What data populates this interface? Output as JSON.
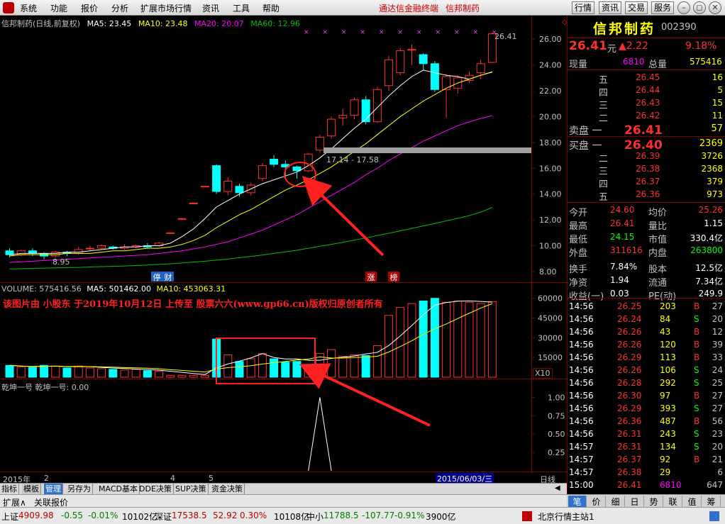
{
  "menu": {
    "logo_icon": "app-logo-icon",
    "items": [
      "系统",
      "功能",
      "报价",
      "分析",
      "扩展市场行情",
      "资讯",
      "工具",
      "帮助"
    ],
    "notice_app": "通达信金融终端",
    "notice_stock": "信邦制药",
    "right_buttons": [
      "行情",
      "资讯",
      "交易",
      "服务"
    ]
  },
  "chart": {
    "title": "信邦制药(日线,前复权)",
    "ma5": "MA5: 23.45",
    "ma10": "MA10: 23.48",
    "ma20": "MA20: 20.07",
    "ma60": "MA60: 12.96",
    "last_price_label": "26.41",
    "low_label": "8.95",
    "range_label": "17.14 - 17.58",
    "tag_ting": "停",
    "tag_cai": "财",
    "tag_zhang": "涨",
    "tag_bang": "榜",
    "volume_legend": {
      "vol": "VOLUME: 575416.56",
      "ma5": "MA5: 501462.00",
      "ma10": "MA10: 453063.31"
    },
    "watermark": "该图片由 小股东 于2019年10月12日 上传至 股票六六(www.gp66.cn)版权归原创者所有",
    "x10_label": "X10",
    "indicator_legend": "乾坤一号  乾坤一号: 0.00",
    "date_axis": [
      "2015年",
      "2",
      "4",
      "5"
    ],
    "cursor_date": "2015/06/03/三",
    "period_label": "日线",
    "colors": {
      "up": "#ff3030",
      "down": "#00ffff",
      "ma5": "#ffffff",
      "ma10": "#ffff00",
      "ma20": "#ff00ff",
      "ma60": "#00c000"
    }
  },
  "chart_data": [
    {
      "type": "candlestick",
      "title": "信邦制药(日线,前复权)",
      "ylim": [
        7.5,
        27
      ],
      "y_ticks": [
        "26.00",
        "24.00",
        "22.00",
        "20.00",
        "18.00",
        "16.00",
        "14.00",
        "12.00",
        "10.00",
        "8.00"
      ],
      "candles": [
        {
          "o": 9.6,
          "c": 9.3,
          "h": 9.8,
          "l": 9.1
        },
        {
          "o": 9.3,
          "c": 9.6,
          "h": 9.7,
          "l": 9.2
        },
        {
          "o": 9.6,
          "c": 9.4,
          "h": 9.8,
          "l": 9.2
        },
        {
          "o": 9.4,
          "c": 9.2,
          "h": 9.5,
          "l": 8.95
        },
        {
          "o": 9.2,
          "c": 9.5,
          "h": 9.6,
          "l": 9.1
        },
        {
          "o": 9.5,
          "c": 9.4,
          "h": 9.6,
          "l": 9.2
        },
        {
          "o": 9.4,
          "c": 9.7,
          "h": 9.9,
          "l": 9.3
        },
        {
          "o": 9.8,
          "c": 9.8,
          "h": 10.0,
          "l": 9.6
        },
        {
          "o": 9.8,
          "c": 10.0,
          "h": 10.1,
          "l": 9.7
        },
        {
          "o": 9.9,
          "c": 9.8,
          "h": 10.0,
          "l": 9.7
        },
        {
          "o": 9.8,
          "c": 9.9,
          "h": 10.1,
          "l": 9.7
        },
        {
          "o": 9.9,
          "c": 10.0,
          "h": 10.1,
          "l": 9.8
        },
        {
          "o": 10.0,
          "c": 9.9,
          "h": 10.2,
          "l": 9.8
        },
        {
          "o": 10.0,
          "c": 10.2,
          "h": 10.3,
          "l": 9.9
        },
        {
          "o": 11.0,
          "c": 11.0,
          "h": 11.0,
          "l": 11.0
        },
        {
          "o": 12.1,
          "c": 12.1,
          "h": 12.1,
          "l": 12.1
        },
        {
          "o": 13.3,
          "c": 13.3,
          "h": 13.3,
          "l": 13.3
        },
        {
          "o": 14.6,
          "c": 14.6,
          "h": 14.6,
          "l": 14.6
        },
        {
          "o": 16.2,
          "c": 14.2,
          "h": 16.3,
          "l": 14.0
        },
        {
          "o": 14.2,
          "c": 15.0,
          "h": 15.3,
          "l": 13.9
        },
        {
          "o": 14.6,
          "c": 14.1,
          "h": 14.8,
          "l": 13.8
        },
        {
          "o": 14.1,
          "c": 14.7,
          "h": 14.9,
          "l": 13.9
        },
        {
          "o": 15.2,
          "c": 16.2,
          "h": 16.4,
          "l": 15.0
        },
        {
          "o": 16.7,
          "c": 16.3,
          "h": 17.0,
          "l": 16.1
        },
        {
          "o": 16.3,
          "c": 16.1,
          "h": 16.6,
          "l": 15.3
        },
        {
          "o": 16.1,
          "c": 15.8,
          "h": 16.2,
          "l": 15.2
        },
        {
          "o": 15.8,
          "c": 17.1,
          "h": 17.2,
          "l": 15.7
        },
        {
          "o": 17.4,
          "c": 18.4,
          "h": 18.6,
          "l": 17.2
        },
        {
          "o": 18.5,
          "c": 19.8,
          "h": 20.0,
          "l": 18.3
        },
        {
          "o": 19.9,
          "c": 20.1,
          "h": 20.6,
          "l": 19.3
        },
        {
          "o": 20.1,
          "c": 21.3,
          "h": 21.5,
          "l": 19.8
        },
        {
          "o": 21.3,
          "c": 19.6,
          "h": 21.6,
          "l": 19.4
        },
        {
          "o": 19.6,
          "c": 22.1,
          "h": 22.3,
          "l": 19.5
        },
        {
          "o": 22.4,
          "c": 24.4,
          "h": 24.7,
          "l": 22.0
        },
        {
          "o": 23.4,
          "c": 25.1,
          "h": 25.3,
          "l": 23.2
        },
        {
          "o": 25.2,
          "c": 25.2,
          "h": 25.6,
          "l": 24.0
        },
        {
          "o": 24.8,
          "c": 24.1,
          "h": 24.9,
          "l": 23.6
        },
        {
          "o": 24.1,
          "c": 22.1,
          "h": 24.3,
          "l": 21.9
        },
        {
          "o": 22.1,
          "c": 23.1,
          "h": 23.3,
          "l": 19.9
        },
        {
          "o": 22.2,
          "c": 23.0,
          "h": 23.2,
          "l": 21.8
        },
        {
          "o": 22.8,
          "c": 23.2,
          "h": 23.5,
          "l": 22.6
        },
        {
          "o": 23.4,
          "c": 24.1,
          "h": 24.4,
          "l": 22.9
        },
        {
          "o": 24.2,
          "c": 26.41,
          "h": 26.5,
          "l": 24.15
        }
      ],
      "ma5": [
        9.3,
        9.4,
        9.4,
        9.4,
        9.4,
        9.5,
        9.5,
        9.6,
        9.7,
        9.8,
        9.9,
        9.9,
        10.0,
        10.0,
        10.2,
        10.7,
        11.3,
        12.1,
        13.0,
        13.5,
        14.0,
        14.4,
        14.8,
        15.1,
        15.4,
        15.7,
        16.2,
        16.8,
        17.5,
        18.3,
        19.1,
        19.8,
        20.7,
        21.6,
        22.4,
        23.1,
        23.6,
        23.4,
        23.2,
        23.1,
        22.9,
        23.2,
        23.45
      ],
      "ma10": [
        9.2,
        9.3,
        9.3,
        9.3,
        9.3,
        9.4,
        9.4,
        9.4,
        9.5,
        9.6,
        9.6,
        9.7,
        9.8,
        9.8,
        9.9,
        10.1,
        10.4,
        10.8,
        11.4,
        11.9,
        12.4,
        12.8,
        13.3,
        13.8,
        14.3,
        14.7,
        15.1,
        15.6,
        16.1,
        16.7,
        17.3,
        17.9,
        18.6,
        19.3,
        20.0,
        20.6,
        21.2,
        21.7,
        22.2,
        22.6,
        22.9,
        23.2,
        23.48
      ],
      "ma20": [
        8.7,
        8.75,
        8.8,
        8.85,
        8.9,
        8.95,
        9.0,
        9.05,
        9.1,
        9.15,
        9.2,
        9.25,
        9.3,
        9.4,
        9.5,
        9.6,
        9.75,
        9.9,
        10.1,
        10.3,
        10.6,
        10.9,
        11.2,
        11.6,
        12.0,
        12.4,
        12.9,
        13.4,
        13.9,
        14.4,
        14.9,
        15.5,
        16.0,
        16.6,
        17.1,
        17.6,
        18.1,
        18.5,
        18.9,
        19.3,
        19.6,
        19.85,
        20.07
      ],
      "ma60": [
        8.2,
        8.22,
        8.24,
        8.26,
        8.28,
        8.3,
        8.32,
        8.35,
        8.38,
        8.4,
        8.43,
        8.46,
        8.5,
        8.55,
        8.6,
        8.66,
        8.73,
        8.8,
        8.88,
        8.97,
        9.07,
        9.17,
        9.28,
        9.4,
        9.52,
        9.65,
        9.8,
        9.95,
        10.1,
        10.26,
        10.43,
        10.6,
        10.78,
        10.96,
        11.15,
        11.34,
        11.53,
        11.72,
        11.92,
        12.12,
        12.33,
        12.6,
        12.96
      ]
    },
    {
      "type": "bar",
      "title": "VOLUME",
      "ylim": [
        0,
        62000
      ],
      "y_ticks": [
        "60000",
        "45000",
        "30000",
        "15000"
      ],
      "unit": "X10",
      "values": [
        9000,
        8000,
        7500,
        9000,
        8500,
        7000,
        8500,
        7000,
        6500,
        6000,
        5500,
        6000,
        5000,
        4500,
        1500,
        1500,
        1500,
        1500,
        29000,
        17000,
        12000,
        14000,
        18000,
        14000,
        11500,
        12000,
        9000,
        18000,
        21000,
        16000,
        17000,
        16500,
        24000,
        47000,
        53000,
        56000,
        58000,
        60000,
        57000,
        58000,
        57000,
        56000,
        57500
      ],
      "up": [
        false,
        true,
        false,
        false,
        true,
        false,
        true,
        true,
        true,
        false,
        true,
        true,
        false,
        true,
        true,
        true,
        true,
        true,
        false,
        true,
        false,
        true,
        true,
        false,
        false,
        false,
        true,
        true,
        true,
        true,
        true,
        false,
        true,
        true,
        true,
        true,
        false,
        false,
        true,
        true,
        true,
        true,
        true
      ]
    },
    {
      "type": "line",
      "title": "乾坤一号",
      "ylim": [
        0,
        1.1
      ],
      "y_ticks": [
        "1.00",
        "0.75",
        "0.50",
        "0.25"
      ],
      "values": [
        0,
        0,
        0,
        0,
        0,
        0,
        0,
        0,
        0,
        0,
        0,
        0,
        0,
        0,
        0,
        0,
        0,
        0,
        0,
        0,
        0,
        0,
        0,
        0,
        0,
        0,
        0,
        1,
        0,
        0,
        0,
        0,
        0,
        0,
        0,
        0,
        0,
        0,
        0,
        0,
        0,
        0,
        0
      ]
    }
  ],
  "quote": {
    "stock_name": "信邦制药",
    "stock_code": "002390",
    "price": "26.41",
    "price_unit": "元",
    "change": "▲2.22",
    "change_pct": "9.18%",
    "xianliang_label": "现量",
    "xianliang": "6810",
    "zongliang_label": "总量",
    "zongliang": "575416",
    "ask": [
      {
        "label": "五",
        "price": "26.45",
        "vol": "16"
      },
      {
        "label": "四",
        "price": "26.44",
        "vol": "5"
      },
      {
        "label": "三",
        "price": "26.43",
        "vol": "15"
      },
      {
        "label": "二",
        "price": "26.42",
        "vol": "11"
      },
      {
        "label": "卖盘 一",
        "price": "26.41",
        "vol": "57"
      }
    ],
    "bid": [
      {
        "label": "买盘 一",
        "price": "26.40",
        "vol": "2369"
      },
      {
        "label": "二",
        "price": "26.39",
        "vol": "3726"
      },
      {
        "label": "三",
        "price": "26.38",
        "vol": "2368"
      },
      {
        "label": "四",
        "price": "26.37",
        "vol": "379"
      },
      {
        "label": "五",
        "price": "26.36",
        "vol": "973"
      }
    ],
    "stats": [
      {
        "l1": "今开",
        "v1": "24.60",
        "l2": "均价",
        "v2": "25.26"
      },
      {
        "l1": "最高",
        "v1": "26.41",
        "l2": "量比",
        "v2": "1.15"
      },
      {
        "l1": "最低",
        "v1": "24.15",
        "l2": "市值",
        "v2": "330.4亿"
      },
      {
        "l1": "外盘",
        "v1": "311616",
        "l2": "内盘",
        "v2": "263800"
      },
      {
        "l1": "换手",
        "v1": "7.84%",
        "l2": "股本",
        "v2": "12.5亿"
      },
      {
        "l1": "净资",
        "v1": "1.94",
        "l2": "流通",
        "v2": "7.34亿"
      },
      {
        "l1": "收益(一)",
        "v1": "0.03",
        "l2": "PE(动)",
        "v2": "249.9"
      }
    ],
    "ticks": [
      {
        "t": "14:56",
        "p": "26.25",
        "v": "203",
        "bs": "B",
        "n": "27"
      },
      {
        "t": "14:56",
        "p": "26.24",
        "v": "84",
        "bs": "S",
        "n": "20"
      },
      {
        "t": "14:56",
        "p": "26.26",
        "v": "43",
        "bs": "B",
        "n": "12"
      },
      {
        "t": "14:56",
        "p": "26.26",
        "v": "120",
        "bs": "B",
        "n": "39"
      },
      {
        "t": "14:56",
        "p": "26.29",
        "v": "113",
        "bs": "B",
        "n": "33"
      },
      {
        "t": "14:56",
        "p": "26.26",
        "v": "106",
        "bs": "S",
        "n": "24"
      },
      {
        "t": "14:56",
        "p": "26.28",
        "v": "292",
        "bs": "S",
        "n": "25"
      },
      {
        "t": "14:56",
        "p": "26.30",
        "v": "97",
        "bs": "B",
        "n": "27"
      },
      {
        "t": "14:56",
        "p": "26.29",
        "v": "393",
        "bs": "S",
        "n": "27"
      },
      {
        "t": "14:56",
        "p": "26.36",
        "v": "487",
        "bs": "B",
        "n": "56"
      },
      {
        "t": "14:56",
        "p": "26.31",
        "v": "243",
        "bs": "S",
        "n": "23"
      },
      {
        "t": "14:57",
        "p": "26.31",
        "v": "134",
        "bs": "S",
        "n": "20"
      },
      {
        "t": "14:57",
        "p": "26.37",
        "v": "92",
        "bs": "B",
        "n": "21"
      },
      {
        "t": "14:57",
        "p": "26.38",
        "v": "29",
        "bs": "",
        "n": "6"
      },
      {
        "t": "15:00",
        "p": "26.41",
        "v": "6810",
        "bs": "",
        "n": "647"
      }
    ]
  },
  "tabs": [
    "指标",
    "模板",
    "管理",
    "另存为",
    "MACD基本",
    "DDE决策",
    "SUP决策",
    "资金决策"
  ],
  "subtabs": [
    "扩展∧",
    "关联报价"
  ],
  "right_tabs": [
    "笔",
    "价",
    "细",
    "日",
    "势",
    "联",
    "值",
    "筹"
  ],
  "status": {
    "sh_label": "上证",
    "sh_val": "4909.98",
    "sh_chg": "-0.55",
    "sh_pct": "-0.01%",
    "sh_amt": "10102亿",
    "sz_label": "深证",
    "sz_val": "17538.5",
    "sz_chg": "52.92",
    "sz_pct": "0.30%",
    "sz_amt": "10108亿",
    "zx_label": "中小",
    "zx_val": "11788.5",
    "zx_chg": "-107.77",
    "zx_pct": "-0.91%",
    "zx_amt": "3900亿",
    "server": "北京行情主站1"
  }
}
